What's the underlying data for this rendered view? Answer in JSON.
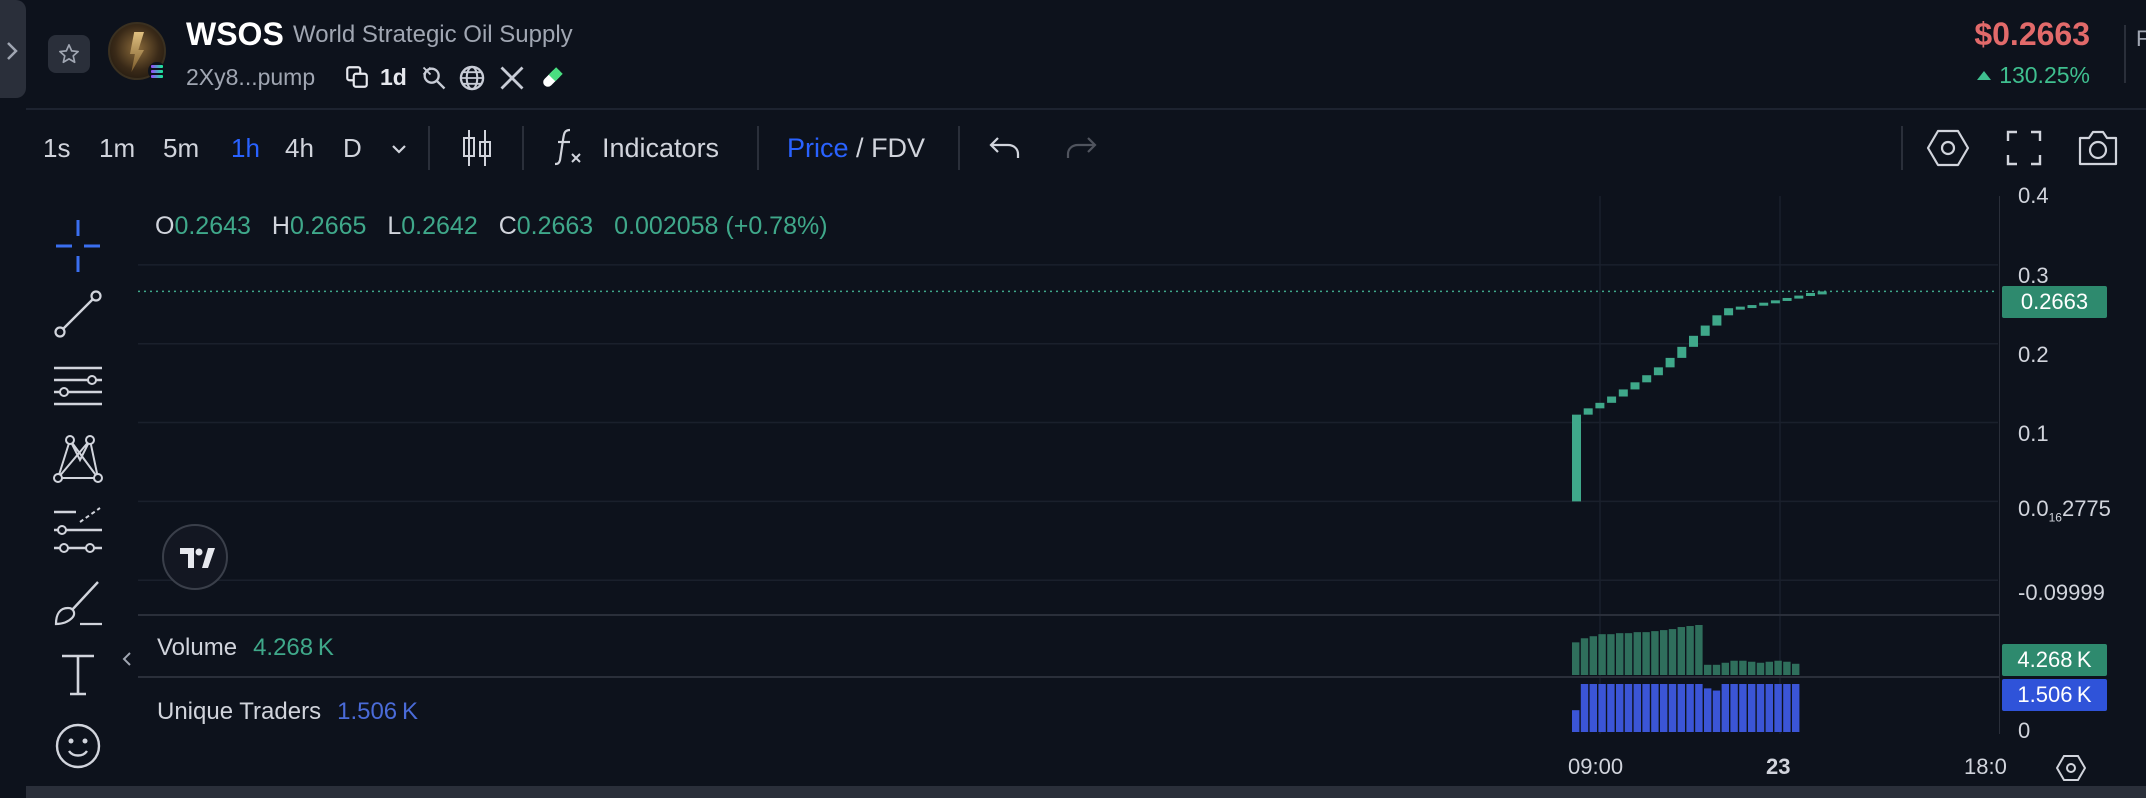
{
  "header": {
    "symbol": "WSOS",
    "full_name": "World Strategic Oil Supply",
    "address": "2Xy8...pump",
    "age": "1d",
    "price": "$0.2663",
    "change": "130.25%",
    "edge_text": "F"
  },
  "toolbar": {
    "timeframes": [
      "1s",
      "1m",
      "5m",
      "1h",
      "4h",
      "D"
    ],
    "active_timeframe": "1h",
    "indicators_label": "Indicators",
    "price_label": "Price",
    "fdv_label": "FDV",
    "separator": "/"
  },
  "left_tools": [
    "crosshair-icon",
    "trend-line-icon",
    "horizontal-lines-icon",
    "pattern-icon",
    "forecast-icon",
    "brush-icon",
    "text-icon",
    "emoji-icon"
  ],
  "legend": {
    "o_key": "O",
    "o": "0.2643",
    "h_key": "H",
    "h": "0.2665",
    "l_key": "L",
    "l": "0.2642",
    "c_key": "C",
    "c": "0.2663",
    "change": "0.002058 (+0.78%)"
  },
  "volume": {
    "label": "Volume",
    "value": "4.268 K",
    "tag": "4.268 K"
  },
  "unique_traders": {
    "label": "Unique Traders",
    "value": "1.506 K",
    "tag": "1.506 K"
  },
  "price_axis": {
    "labels": [
      "0.4",
      "0.3",
      "0.2",
      "0.1",
      "0.0",
      "-0.09999",
      "0"
    ],
    "zero_label_sub": "16",
    "zero_label_tail": "2775",
    "current_price_tag": "0.2663"
  },
  "time_axis": {
    "labels": [
      "09:00",
      "23",
      "18:0"
    ]
  },
  "colors": {
    "up": "#3fa88a",
    "down": "#e26a6a",
    "accent": "#2962ff",
    "traders": "#3b55d6"
  },
  "chart_data": [
    {
      "type": "candlestick",
      "title": "",
      "ylim": [
        -0.12,
        0.4
      ],
      "note_x": "hourly candles starting at 09:00",
      "open": [
        0.0,
        0.11,
        0.118,
        0.125,
        0.133,
        0.142,
        0.151,
        0.16,
        0.17,
        0.182,
        0.196,
        0.21,
        0.223,
        0.236,
        0.245,
        0.247,
        0.249,
        0.252,
        0.255,
        0.258,
        0.261,
        0.2643
      ],
      "close": [
        0.11,
        0.118,
        0.125,
        0.133,
        0.142,
        0.151,
        0.16,
        0.17,
        0.182,
        0.196,
        0.21,
        0.223,
        0.236,
        0.245,
        0.247,
        0.249,
        0.252,
        0.255,
        0.258,
        0.261,
        0.2643,
        0.2663
      ],
      "last_price": 0.2663
    },
    {
      "type": "bar",
      "name": "Volume",
      "values": [
        32,
        36,
        38,
        40,
        40,
        41,
        41,
        42,
        42,
        43,
        44,
        45,
        47,
        48,
        49,
        10,
        10,
        12,
        14,
        14,
        13,
        12,
        13,
        14,
        13,
        11
      ],
      "last_value": "4.268 K"
    },
    {
      "type": "bar",
      "name": "Unique Traders",
      "values": [
        20,
        44,
        44,
        44,
        44,
        44,
        44,
        44,
        44,
        44,
        44,
        44,
        44,
        44,
        44,
        40,
        38,
        44,
        44,
        44,
        44,
        44,
        44,
        44,
        44,
        44
      ],
      "last_value": "1.506 K"
    }
  ]
}
